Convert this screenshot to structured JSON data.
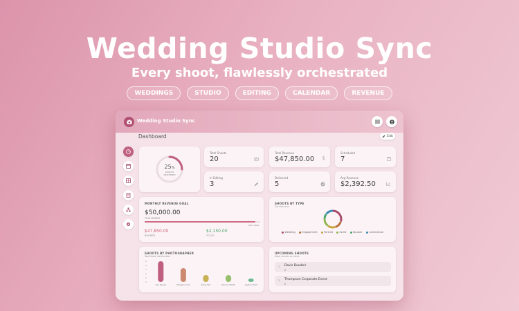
{
  "hero": {
    "title": "Wedding Studio Sync",
    "subtitle": "Every shoot, flawlessly orchestrated",
    "pills": [
      "WEDDINGS",
      "STUDIO",
      "EDITING",
      "CALENDAR",
      "REVENUE"
    ]
  },
  "app": {
    "title": "Wedding Studio Sync",
    "page_title": "Dashboard",
    "edit_label": "Edit",
    "sidebar_icons": [
      "dashboard-icon",
      "calendar-icon",
      "calendar-grid-icon",
      "schedule-icon",
      "team-icon",
      "settings-icon"
    ]
  },
  "progress": {
    "percent_label": "25",
    "percent_unit": "%",
    "caption_line1": "SHOOTS",
    "caption_line2": "DELIVERED",
    "fraction": 0.25
  },
  "stats": [
    {
      "label": "Total Shoots",
      "value": "20",
      "icon": "camera-icon"
    },
    {
      "label": "Total Revenue",
      "value": "$47,850.00",
      "icon": "dollar-icon"
    },
    {
      "label": "Scheduled",
      "value": "7",
      "icon": "calendar-icon"
    },
    {
      "label": "In Editing",
      "value": "3",
      "icon": "pencil-icon"
    },
    {
      "label": "Delivered",
      "value": "5",
      "icon": "check-icon"
    },
    {
      "label": "Avg Revenue",
      "value": "$2,392.50",
      "icon": "trend-icon"
    }
  ],
  "revenue_goal": {
    "title": "MONTHLY REVENUE GOAL",
    "goal": "$50,000.00",
    "goal_caption": "THIS MONTH",
    "bar_end_label": "96% GOAL",
    "booked_value": "$47,850.00",
    "booked_label": "BOOKED",
    "togo_value": "$2,150.00",
    "togo_label": "TO GO",
    "fraction": 0.96
  },
  "shoots_by_type": {
    "title": "SHOOTS BY TYPE",
    "subtitle": "Service mix",
    "legend": [
      {
        "name": "Wedding",
        "color": "#a84a6d",
        "value": 6
      },
      {
        "name": "Engagement",
        "color": "#b8703c",
        "value": 3
      },
      {
        "name": "Portrait",
        "color": "#c7a33e",
        "value": 3
      },
      {
        "name": "Event",
        "color": "#91b651",
        "value": 3
      },
      {
        "name": "Boudoir",
        "color": "#4aa56e",
        "value": 2
      },
      {
        "name": "Commercial",
        "color": "#3f8ab1",
        "value": 3
      }
    ]
  },
  "chart_data": {
    "type": "bar",
    "title": "SHOOTS BY PHOTOGRAPHER",
    "subtitle": "Workload distribution",
    "categories": [
      "Ava Reyes",
      "Morgan Cole",
      "Kenji Tait",
      "Sienna Wolfe",
      "Jayden Hart"
    ],
    "values": [
      6,
      4,
      2,
      2,
      1
    ],
    "colors": [
      "#bf5f80",
      "#cc8a70",
      "#c7b155",
      "#97bf6c",
      "#6db890"
    ],
    "yticks": [
      "6",
      "4",
      "3",
      "2",
      "1",
      "0"
    ],
    "ylim": [
      0,
      6
    ]
  },
  "upcoming": {
    "title": "UPCOMING SHOOTS",
    "subtitle": "Next shoots on deck",
    "items": [
      {
        "num": "1",
        "name": "Davis Boudoir",
        "sub": "6"
      },
      {
        "num": "2",
        "name": "Thompson Corporate Event",
        "sub": "6"
      }
    ]
  }
}
